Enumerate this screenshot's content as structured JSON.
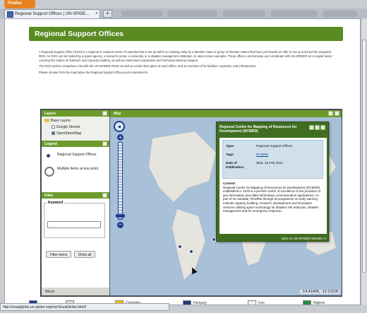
{
  "browser": {
    "app_button_label": "Firefox",
    "tab_title": "Regional Support Offices | UN-SPIDE...",
    "new_tab_label": "+",
    "status_url": "http://visualglobe.un-spider.org/rso/VisualGlobe.html#"
  },
  "page": {
    "title": "Regional Support Offices",
    "intro": [
      "A Regional Support Office (RSO) is a regional or national centre of expertise that is set up within an existing entity by a Member State or group of Member States that have put forward an offer to set up and fund the proposed RSO. An RSO can be hosted by a space agency, a research center, a university, or a disaster management institution, to name some examples. These offices communicate and coordinate with UN-SPIDER on a regular basis, covering the realms of Outreach and Capacity building, as well as Horizontal Cooperation and Technical Advisory Support.",
      "The RSO section comprises a list with the UN-SPIDER RSOs as well as a brief description of each Office, and an overview of its facilities, expertise, and infrastructure.",
      "Please choose from the map below the Regional Support Office you're interested in."
    ]
  },
  "left_panel": {
    "layers_title": "Layers",
    "base_layers_label": "Base Layers",
    "layers": [
      "Google Streets",
      "OpenStreetMap"
    ],
    "legend_title": "Legend",
    "legend_items": [
      "Regional Support Offices",
      "Multiple items at one point"
    ],
    "filter_title": "Filter",
    "keyword_label": "Keyword",
    "keyword_value": "",
    "filter_button": "Filter items",
    "show_all_button": "Show all",
    "about_label": "About"
  },
  "map": {
    "title": "Map",
    "coordinates": "-14.41406, -12.21118",
    "popup": {
      "title": "Regional Centre for Mapping of Resources for Development (RCMRD)",
      "fields": [
        {
          "key": "Type:",
          "value": "Regional Support Offices"
        },
        {
          "key": "Tags:",
          "value": "RCMRD"
        },
        {
          "key": "Date of Publication:",
          "value": "Wed, 15 Feb 2012"
        }
      ],
      "content_label": "Content:",
      "content": "Regional Centre for Mapping of Resources for Development (RCMRD) established in 1975 is a premier centre of excellence in the provision of geo-information and allied information communication applications. As part of its mandate, RCMRD through its programme on early warning extends capacity building, research, development and innovation services utilizing space technology for disaster risk reduction, disaster management and for emergency response.",
      "link": "open on UN-SPIDER Website >>"
    }
  },
  "flags": [
    "Colombia",
    "Hungary",
    "Iran",
    "Nigeria"
  ],
  "colors": {
    "header_green": "#5a8a22",
    "panel_green": "#6c9b2b",
    "popup_green": "#3f6e21",
    "ocean": "#a8c0d8"
  }
}
